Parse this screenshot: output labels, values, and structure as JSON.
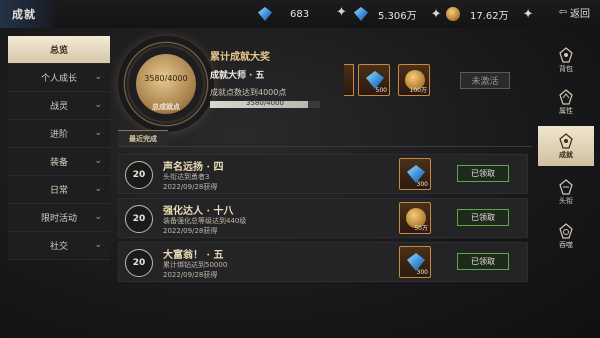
{
  "window": {
    "title": "成就"
  },
  "topbar": {
    "resources": [
      {
        "icon": "diamond-icon",
        "value": "683"
      },
      {
        "icon": "gem-icon",
        "value": "5.306万"
      },
      {
        "icon": "gold-coin-icon",
        "value": "17.62万"
      }
    ],
    "back_label": "返回"
  },
  "left_menu": [
    {
      "label": "总览",
      "active": true
    },
    {
      "label": "个人成长"
    },
    {
      "label": "战灵"
    },
    {
      "label": "进阶"
    },
    {
      "label": "装备"
    },
    {
      "label": "日常"
    },
    {
      "label": "限时活动"
    },
    {
      "label": "社交"
    }
  ],
  "hero": {
    "progress_text": "3580/4000",
    "progress_fraction": 0.895,
    "points_label": "总成就点",
    "title": "累计成就大奖",
    "rank": "成就大师 · 五",
    "desc": "成就点数达到4000点",
    "rewards": [
      {
        "icon": "diamond-icon",
        "qty": "500"
      },
      {
        "icon": "gold-coin-icon",
        "qty": "100万"
      }
    ],
    "status_label": "未激活"
  },
  "recent": {
    "tab_label": "最近完成",
    "items": [
      {
        "points": "20",
        "title": "声名远扬 · 四",
        "desc": "头衔达到勇者3",
        "date": "2022/09/28获得",
        "reward_icon": "diamond-icon",
        "reward_qty": "300",
        "status": "已领取"
      },
      {
        "points": "20",
        "title": "强化达人 · 十八",
        "desc": "装备强化总等级达到440级",
        "date": "2022/09/28获得",
        "reward_icon": "gold-coin-icon",
        "reward_qty": "50万",
        "status": "已领取"
      },
      {
        "points": "20",
        "title": "大富翁！ · 五",
        "desc": "累计绑钻达到50000",
        "date": "2022/09/28获得",
        "reward_icon": "diamond-icon",
        "reward_qty": "300",
        "status": "已领取"
      }
    ]
  },
  "right_nav": [
    {
      "label": "背包"
    },
    {
      "label": "属性"
    },
    {
      "label": "成就",
      "active": true
    },
    {
      "label": "头衔"
    },
    {
      "label": "吞噬"
    }
  ],
  "colors": {
    "accent_gold": "#e8c88a",
    "claimed_green": "#5aa848",
    "reward_border": "#c88840"
  }
}
